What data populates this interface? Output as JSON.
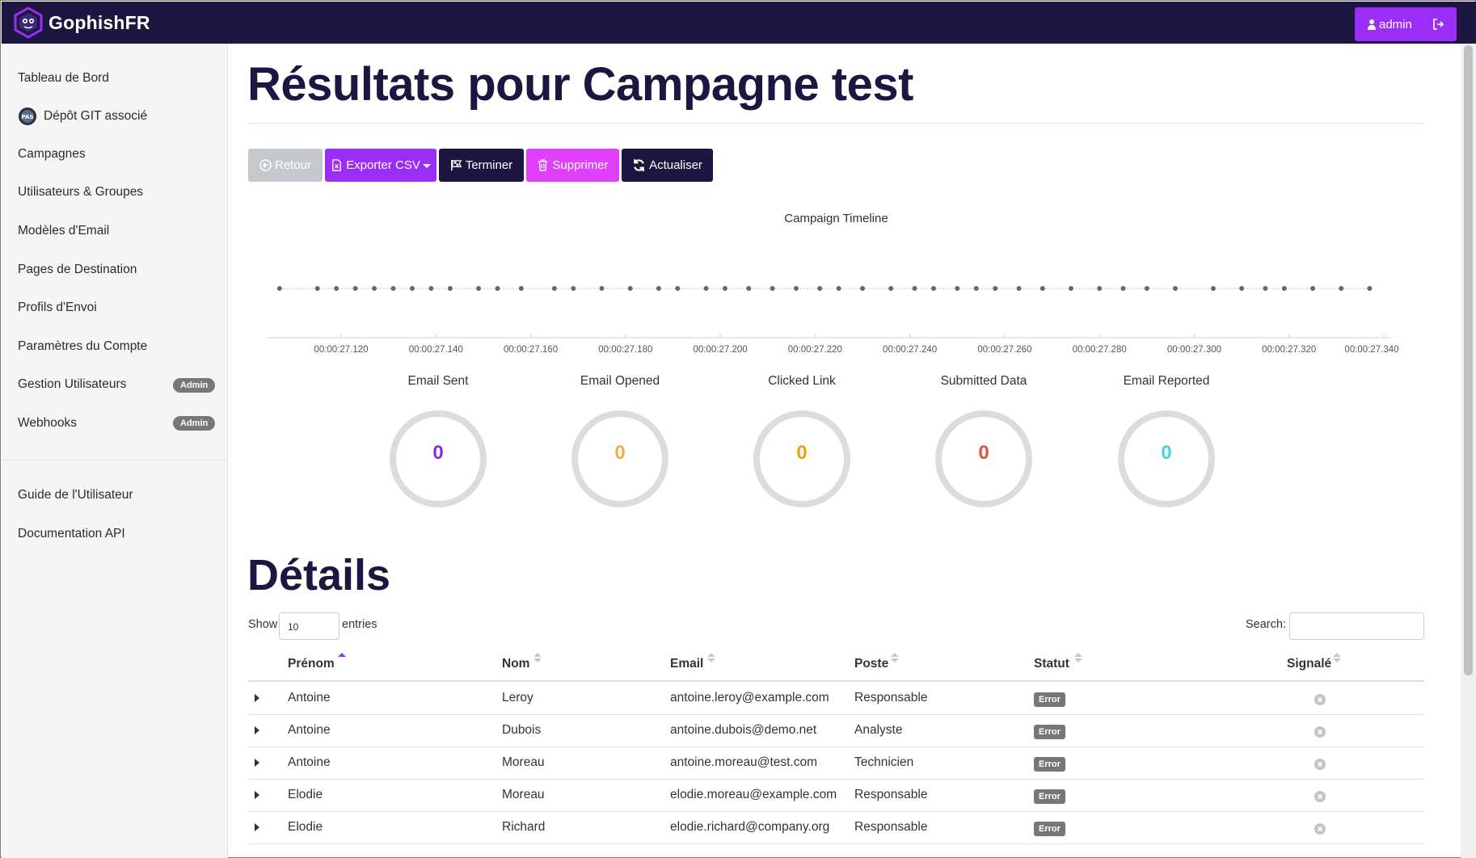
{
  "app": {
    "brand": "GophishFR",
    "user_label": "admin"
  },
  "colors": {
    "navbar": "#1c1640",
    "accent": "#9a2ef7",
    "delete": "#e040fb",
    "sent": "#8a2be2",
    "opened": "#f0ad4e",
    "clicked": "#f39c12",
    "submitted": "#e74c3c",
    "reported": "#45d6d6"
  },
  "sidebar": {
    "items": [
      {
        "label": "Tableau de Bord"
      },
      {
        "label": "Dépôt GIT associé",
        "icon": "git-repo-logo-icon"
      },
      {
        "label": "Campagnes"
      },
      {
        "label": "Utilisateurs & Groupes"
      },
      {
        "label": "Modèles d'Email"
      },
      {
        "label": "Pages de Destination"
      },
      {
        "label": "Profils d'Envoi"
      },
      {
        "label": "Paramètres du Compte"
      },
      {
        "label": "Gestion Utilisateurs",
        "badge": "Admin"
      },
      {
        "label": "Webhooks",
        "badge": "Admin"
      }
    ],
    "footer_items": [
      {
        "label": "Guide de l'Utilisateur"
      },
      {
        "label": "Documentation API"
      }
    ]
  },
  "main": {
    "title": "Résultats pour Campagne test",
    "buttons": {
      "back": "Retour",
      "export": "Exporter CSV",
      "end": "Terminer",
      "delete": "Supprimer",
      "refresh": "Actualiser"
    },
    "timeline_title": "Campaign Timeline",
    "details_title": "Détails"
  },
  "chart_data": {
    "type": "scatter",
    "title": "Campaign Timeline",
    "x_ticks": [
      "00:00:27.120",
      "00:00:27.140",
      "00:00:27.160",
      "00:00:27.180",
      "00:00:27.200",
      "00:00:27.220",
      "00:00:27.240",
      "00:00:27.260",
      "00:00:27.280",
      "00:00:27.300",
      "00:00:27.320",
      "00:00:27.340"
    ],
    "x_ms": [
      27.107,
      27.115,
      27.119,
      27.123,
      27.127,
      27.131,
      27.135,
      27.139,
      27.143,
      27.149,
      27.153,
      27.158,
      27.165,
      27.169,
      27.175,
      27.181,
      27.187,
      27.191,
      27.197,
      27.201,
      27.206,
      27.211,
      27.216,
      27.221,
      27.225,
      27.23,
      27.236,
      27.241,
      27.245,
      27.25,
      27.254,
      27.258,
      27.263,
      27.268,
      27.274,
      27.28,
      27.285,
      27.29,
      27.296,
      27.304,
      27.31,
      27.315,
      27.319,
      27.325,
      27.331,
      27.337
    ],
    "y": 0
  },
  "stats": [
    {
      "label": "Email Sent",
      "value": "0",
      "color": "#8a2be2"
    },
    {
      "label": "Email Opened",
      "value": "0",
      "color": "#f0ad4e"
    },
    {
      "label": "Clicked Link",
      "value": "0",
      "color": "#f39c12"
    },
    {
      "label": "Submitted Data",
      "value": "0",
      "color": "#e74c3c"
    },
    {
      "label": "Email Reported",
      "value": "0",
      "color": "#45d6d6"
    }
  ],
  "table": {
    "show_label": "Show",
    "length_value": "10",
    "entries_label": "entries",
    "search_label": "Search:",
    "headers": [
      "Prénom",
      "Nom",
      "Email",
      "Poste",
      "Statut",
      "Signalé"
    ],
    "rows": [
      {
        "first": "Antoine",
        "last": "Leroy",
        "email": "antoine.leroy@example.com",
        "position": "Responsable",
        "status": "Error"
      },
      {
        "first": "Antoine",
        "last": "Dubois",
        "email": "antoine.dubois@demo.net",
        "position": "Analyste",
        "status": "Error"
      },
      {
        "first": "Antoine",
        "last": "Moreau",
        "email": "antoine.moreau@test.com",
        "position": "Technicien",
        "status": "Error"
      },
      {
        "first": "Elodie",
        "last": "Moreau",
        "email": "elodie.moreau@example.com",
        "position": "Responsable",
        "status": "Error"
      },
      {
        "first": "Elodie",
        "last": "Richard",
        "email": "elodie.richard@company.org",
        "position": "Responsable",
        "status": "Error"
      }
    ]
  }
}
